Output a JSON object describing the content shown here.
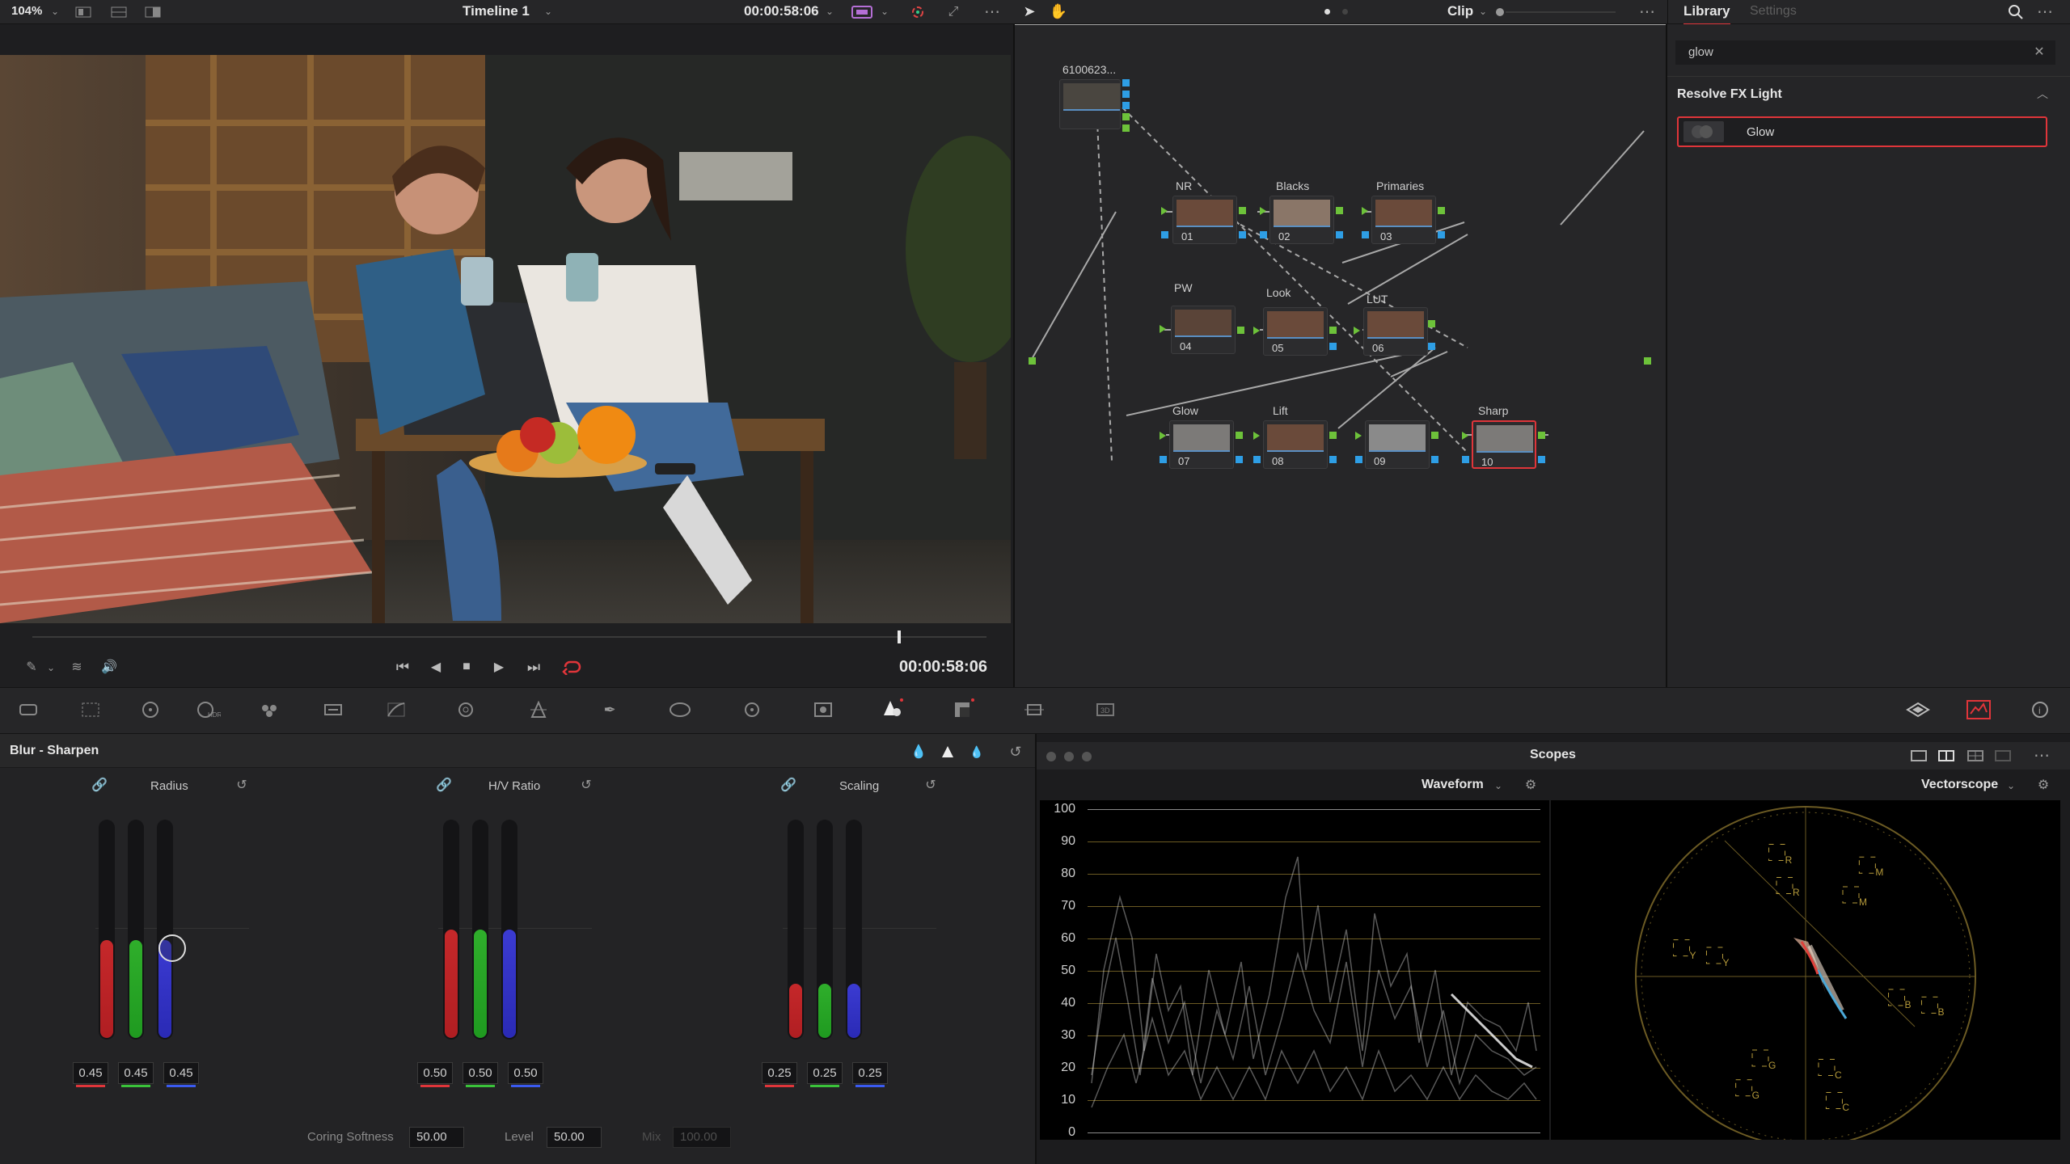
{
  "topbar": {
    "zoom": "104%",
    "timeline": "Timeline 1",
    "timecode": "00:00:58:06",
    "clip_mode": "Clip",
    "tabs": [
      "Library",
      "Settings"
    ]
  },
  "viewer": {
    "timecode": "00:00:58:06"
  },
  "library": {
    "search_value": "glow",
    "section": "Resolve FX Light",
    "items": [
      {
        "label": "Glow",
        "selected": true
      }
    ]
  },
  "nodes": {
    "source_label": "6100623...",
    "list": [
      {
        "num": "01",
        "label": "NR"
      },
      {
        "num": "02",
        "label": "Blacks"
      },
      {
        "num": "03",
        "label": "Primaries"
      },
      {
        "num": "04",
        "label": "PW"
      },
      {
        "num": "05",
        "label": "Look"
      },
      {
        "num": "06",
        "label": "LUT"
      },
      {
        "num": "07",
        "label": "Glow"
      },
      {
        "num": "08",
        "label": "Lift"
      },
      {
        "num": "09",
        "label": ""
      },
      {
        "num": "10",
        "label": "Sharp",
        "selected": true
      }
    ]
  },
  "blur_panel": {
    "title": "Blur - Sharpen",
    "groups": [
      {
        "label": "Radius",
        "values": [
          "0.45",
          "0.45",
          "0.45"
        ],
        "levels": [
          0.45,
          0.45,
          0.45
        ]
      },
      {
        "label": "H/V Ratio",
        "values": [
          "0.50",
          "0.50",
          "0.50"
        ],
        "levels": [
          0.5,
          0.5,
          0.5
        ]
      },
      {
        "label": "Scaling",
        "values": [
          "0.25",
          "0.25",
          "0.25"
        ],
        "levels": [
          0.25,
          0.25,
          0.25
        ]
      }
    ],
    "coring_softness_label": "Coring Softness",
    "coring_softness": "50.00",
    "level_label": "Level",
    "level": "50.00",
    "mix_label": "Mix",
    "mix": "100.00"
  },
  "scopes": {
    "title": "Scopes",
    "left": "Waveform",
    "right": "Vectorscope",
    "waveform_axis": [
      "100",
      "90",
      "80",
      "70",
      "60",
      "50",
      "40",
      "30",
      "20",
      "10",
      "0"
    ],
    "vector_targets": [
      "R",
      "M",
      "B",
      "C",
      "G",
      "Y",
      "R",
      "M",
      "B",
      "C",
      "G",
      "Y"
    ]
  },
  "colors": {
    "accent_red": "#e0353a",
    "node_green": "#6dc23a",
    "node_blue": "#2e9ee5",
    "tab_active": "#e0353a"
  }
}
